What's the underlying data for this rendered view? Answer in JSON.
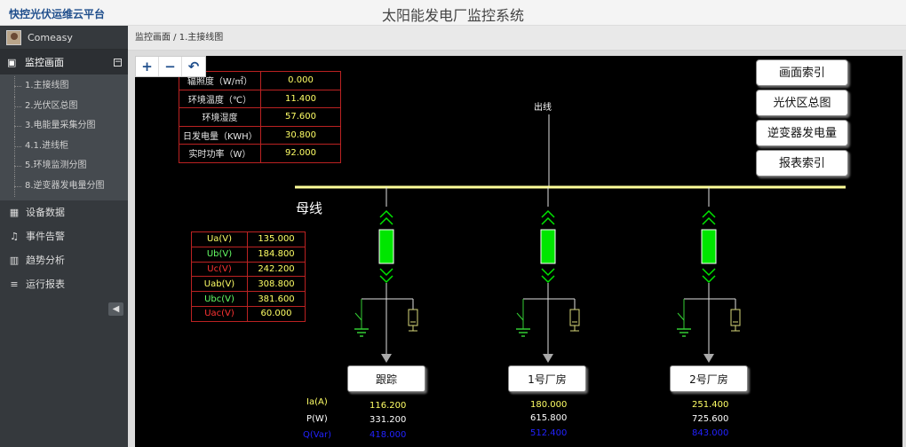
{
  "header": {
    "brand": "快控光伏运维云平台",
    "title": "太阳能发电厂监控系统"
  },
  "sidebar": {
    "user": "Comeasy",
    "main_item": {
      "label": "监控画面",
      "icon": "image-icon"
    },
    "subitems": [
      {
        "label": "1.主接线图"
      },
      {
        "label": "2.光伏区总图"
      },
      {
        "label": "3.电能量采集分图"
      },
      {
        "label": "4.1.进线柜"
      },
      {
        "label": "5.环境监测分图"
      },
      {
        "label": "8.逆变器发电量分图"
      }
    ],
    "items": [
      {
        "label": "设备数据",
        "icon": "table-icon"
      },
      {
        "label": "事件告警",
        "icon": "bell-icon"
      },
      {
        "label": "趋势分析",
        "icon": "bar-chart-icon"
      },
      {
        "label": "运行报表",
        "icon": "list-icon"
      }
    ]
  },
  "breadcrumb": "监控画面 /  1.主接线图",
  "diagram": {
    "env": [
      {
        "label": "辐照度（W/㎡）",
        "value": "0.000"
      },
      {
        "label": "环境温度（℃）",
        "value": "11.400"
      },
      {
        "label": "环境湿度",
        "value": "57.600"
      },
      {
        "label": "日发电量（KWH）",
        "value": "30.800"
      },
      {
        "label": "实时功率（W）",
        "value": "92.000"
      }
    ],
    "voltages": [
      {
        "label": "Ua(V)",
        "value": "135.000",
        "color": "#ffff66"
      },
      {
        "label": "Ub(V)",
        "value": "184.800",
        "color": "#66ff66"
      },
      {
        "label": "Uc(V)",
        "value": "242.200",
        "color": "#ff3333"
      },
      {
        "label": "Uab(V)",
        "value": "308.800",
        "color": "#ffff66"
      },
      {
        "label": "Ubc(V)",
        "value": "381.600",
        "color": "#66ff66"
      },
      {
        "label": "Uac(V)",
        "value": "60.000",
        "color": "#ff3333"
      }
    ],
    "outgoing_label": "出线",
    "bus_label": "母线",
    "nav_buttons": [
      "画面索引",
      "光伏区总图",
      "逆变器发电量",
      "报表索引"
    ],
    "feeders": [
      {
        "name": "跟踪",
        "ia": "116.200",
        "p": "331.200",
        "q": "418.000"
      },
      {
        "name": "1号厂房",
        "ia": "180.000",
        "p": "615.800",
        "q": "512.400"
      },
      {
        "name": "2号厂房",
        "ia": "251.400",
        "p": "725.600",
        "q": "843.000"
      }
    ],
    "measure_labels": [
      "Ia(A)",
      "P(W)",
      "Q(Var)"
    ],
    "colors": {
      "bus": "#ffff99",
      "breaker": "#00e600",
      "wire": "#e0e0e0",
      "ground": "#33cc33",
      "measure_ia": "#ffff66",
      "measure_p": "#ffffff",
      "measure_q": "#2222ff"
    }
  }
}
